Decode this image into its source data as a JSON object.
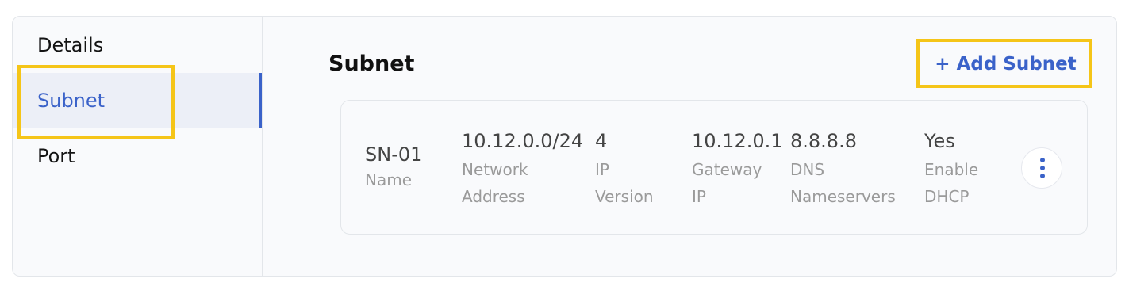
{
  "sidebar": {
    "items": [
      {
        "label": "Details"
      },
      {
        "label": "Subnet"
      },
      {
        "label": "Port"
      }
    ]
  },
  "main": {
    "title": "Subnet",
    "add_button_label": "+ Add Subnet"
  },
  "subnet_card": {
    "name": {
      "value": "SN-01",
      "label": "Name"
    },
    "network_address": {
      "value": "10.12.0.0/24",
      "label_line1": "Network",
      "label_line2": "Address"
    },
    "ip_version": {
      "value": "4",
      "label_line1": "IP",
      "label_line2": "Version"
    },
    "gateway_ip": {
      "value": "10.12.0.1",
      "label_line1": "Gateway",
      "label_line2": "IP"
    },
    "dns_nameservers": {
      "value": "8.8.8.8",
      "label_line1": "DNS",
      "label_line2": "Nameservers"
    },
    "enable_dhcp": {
      "value": "Yes",
      "label_line1": "Enable",
      "label_line2": "DHCP"
    },
    "menu_icon": "vertical-ellipsis-icon"
  },
  "colors": {
    "accent": "#3a62c9",
    "highlight": "#f5c518",
    "active_nav_background": "#eceff7"
  }
}
